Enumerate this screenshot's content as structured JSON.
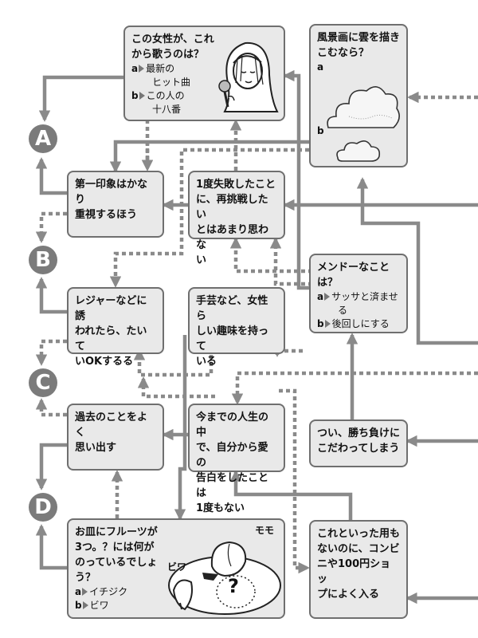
{
  "results": [
    "A",
    "B",
    "C",
    "D"
  ],
  "boxes": {
    "singer": {
      "q1": "この女性が、これ",
      "q2": "から歌うのは？",
      "a_mark": "a",
      "a1": "最新の",
      "a2": "ヒット曲",
      "b_mark": "b",
      "b1": "この人の",
      "b2": "十八番"
    },
    "landscape": {
      "q1": "風景画に雲を描き",
      "q2": "こむなら？",
      "a_mark": "a",
      "b_mark": "b"
    },
    "first_impression": {
      "l1": "第一印象はかなり",
      "l2": "重視するほう"
    },
    "retry": {
      "l1": "1度失敗したこと",
      "l2": "に、再挑戦したい",
      "l3": "とはあまり思わな",
      "l4": "い"
    },
    "bother": {
      "q1": "メンドーなこと",
      "q2": "は？",
      "a_mark": "a",
      "a1": "サッサと済ませ",
      "a2": "る",
      "b_mark": "b",
      "b1": "後回しにする"
    },
    "leisure": {
      "l1": "レジャーなどに誘",
      "l2": "われたら、たいて",
      "l3": "いOKするる"
    },
    "crafts": {
      "l1": "手芸など、女性ら",
      "l2": "しい趣味を持って",
      "l3": "いる"
    },
    "past": {
      "l1": "過去のことをよく",
      "l2": "思い出す"
    },
    "confess": {
      "l1": "今までの人生の中",
      "l2": "で、自分から愛の",
      "l3": "告白をしたことは",
      "l4": "1度もない"
    },
    "win_lose": {
      "l1": "つい、勝ち負けに",
      "l2": "こだわってしまう"
    },
    "fruit": {
      "q1": "お皿にフルーツが",
      "q2": "3つ。？には何が",
      "q3": "のっているでしょ",
      "q4": "う？",
      "a_mark": "a",
      "a1": "イチジク",
      "b_mark": "b",
      "b1": "ビワ",
      "label_peach": "モモ",
      "label_loquat": "ビワ",
      "mystery": "?"
    },
    "convenience": {
      "l1": "これといった用も",
      "l2": "ないのに、コンビ",
      "l3": "ニや100円ショッ",
      "l4": "プによく入る"
    }
  },
  "colors": {
    "box_fill": "#e9e9e9",
    "box_border": "#6f6f6f",
    "line": "#8a8a8a",
    "circle": "#7b7b7b"
  }
}
